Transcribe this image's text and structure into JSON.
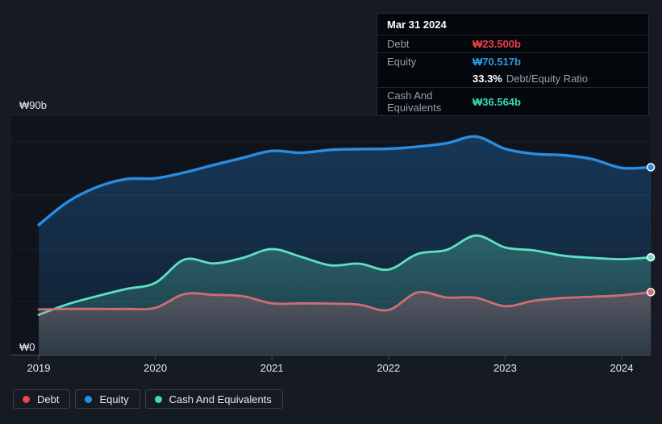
{
  "chart": {
    "y_top_label": "₩90b",
    "y_bottom_label": "₩0"
  },
  "tooltip": {
    "date": "Mar 31 2024",
    "debt_label": "Debt",
    "debt_value": "₩23.500b",
    "equity_label": "Equity",
    "equity_value": "₩70.517b",
    "ratio_percent": "33.3%",
    "ratio_text": "Debt/Equity Ratio",
    "cash_label": "Cash And Equivalents",
    "cash_value": "₩36.564b"
  },
  "legend": {
    "items": [
      {
        "label": "Debt",
        "color": "#e5484d"
      },
      {
        "label": "Equity",
        "color": "#2590ea"
      },
      {
        "label": "Cash And Equivalents",
        "color": "#3fd9bd"
      }
    ]
  },
  "chart_data": {
    "type": "area",
    "x": [
      2019.0,
      2019.25,
      2019.5,
      2019.75,
      2020.0,
      2020.25,
      2020.5,
      2020.75,
      2021.0,
      2021.25,
      2021.5,
      2021.75,
      2022.0,
      2022.25,
      2022.5,
      2022.75,
      2023.0,
      2023.25,
      2023.5,
      2023.75,
      2024.0,
      2024.25
    ],
    "x_ticks": [
      2019,
      2020,
      2021,
      2022,
      2023,
      2024
    ],
    "ylim": [
      0,
      90
    ],
    "y_gridline_values": [
      90,
      80,
      60,
      40,
      20
    ],
    "unit": "₩ billions",
    "series": [
      {
        "name": "Debt",
        "color": "#cf6d75",
        "values": [
          17.0,
          17.2,
          17.2,
          17.2,
          17.6,
          22.8,
          22.5,
          22.0,
          19.3,
          19.3,
          19.2,
          18.8,
          16.8,
          23.4,
          21.5,
          21.4,
          18.2,
          20.3,
          21.3,
          21.8,
          22.3,
          23.5
        ]
      },
      {
        "name": "Equity",
        "color": "#2b8ce0",
        "values": [
          48.8,
          57.5,
          63.0,
          66.0,
          66.3,
          68.5,
          71.3,
          74.0,
          76.6,
          75.9,
          77.0,
          77.3,
          77.4,
          78.2,
          79.5,
          82.0,
          77.4,
          75.5,
          75.0,
          73.5,
          70.2,
          70.5
        ]
      },
      {
        "name": "Cash And Equivalents",
        "color": "#5fe0c2",
        "values": [
          15.0,
          19.0,
          22.0,
          24.7,
          27.0,
          35.8,
          34.3,
          36.4,
          39.7,
          36.8,
          33.6,
          34.2,
          32.0,
          37.9,
          39.4,
          44.8,
          40.3,
          39.2,
          37.2,
          36.4,
          35.9,
          36.6
        ]
      }
    ],
    "draw_order": [
      1,
      2,
      0
    ],
    "last_point": {
      "date": "Mar 31 2024",
      "Debt": 23.5,
      "Equity": 70.517,
      "Cash And Equivalents": 36.564
    },
    "legend_position": "bottom-left",
    "grid": true
  }
}
